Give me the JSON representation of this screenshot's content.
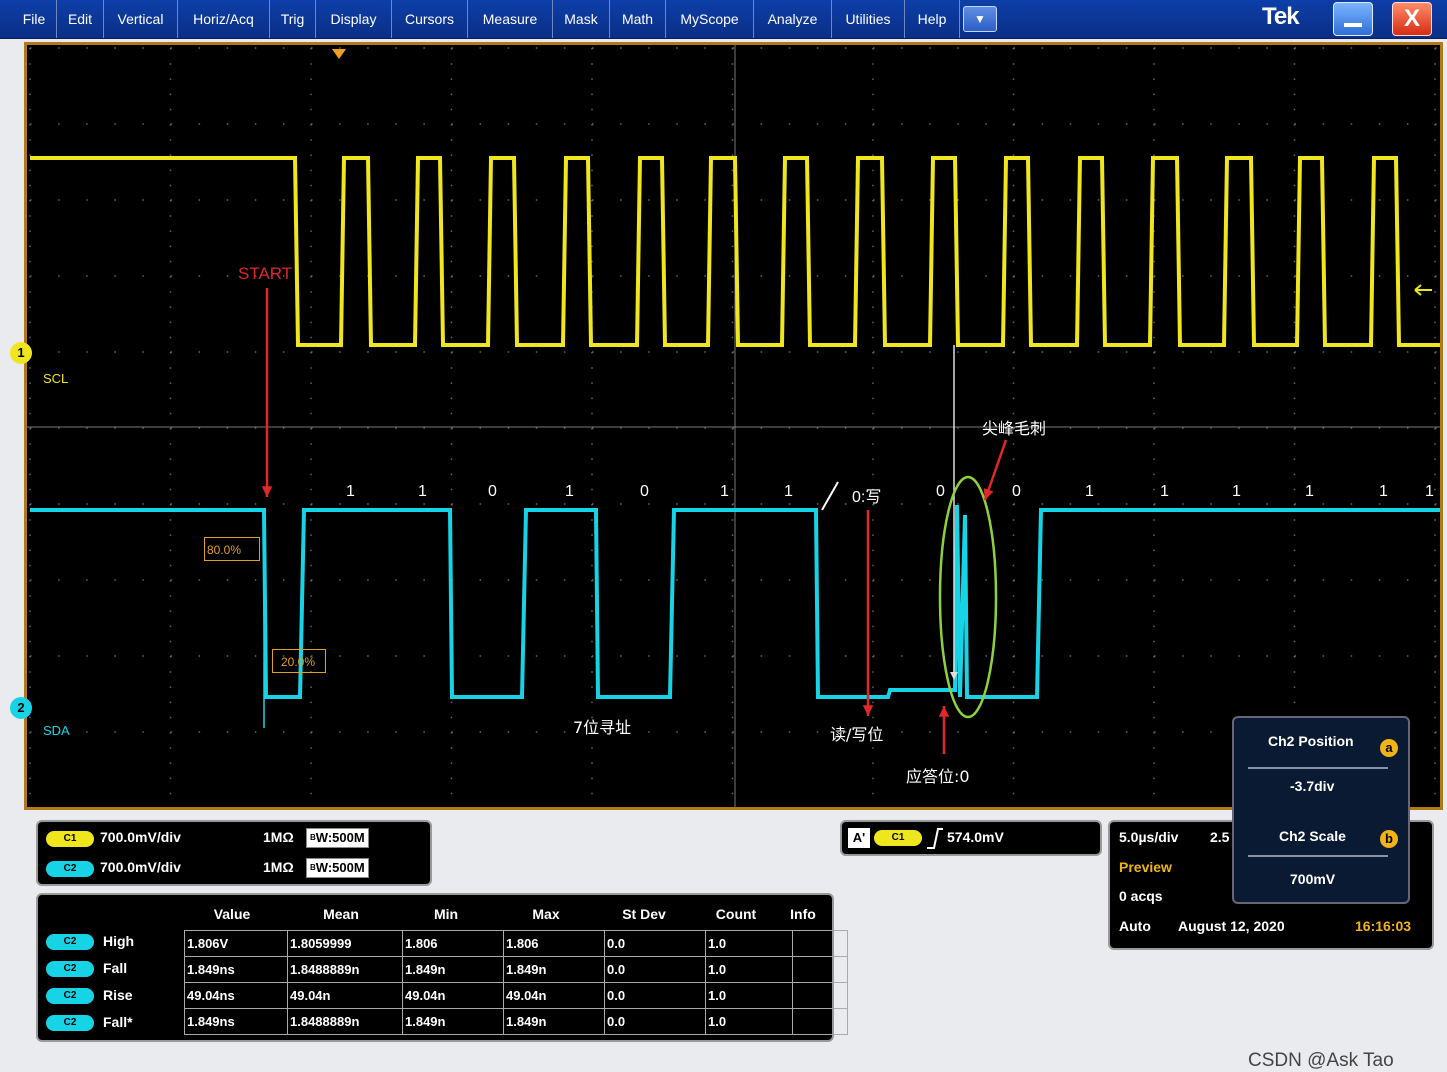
{
  "menubar": {
    "items": [
      "File",
      "Edit",
      "Vertical",
      "Horiz/Acq",
      "Trig",
      "Display",
      "Cursors",
      "Measure",
      "Mask",
      "Math",
      "MyScope",
      "Analyze",
      "Utilities",
      "Help"
    ],
    "brand": "Tek",
    "dropdown_icon": "chevron-down-icon",
    "close_glyph": "X"
  },
  "display": {
    "start_label": "START",
    "pct_high": "80.0%",
    "pct_low": "20.0%",
    "ch1_marker": "1",
    "ch2_marker": "2",
    "ch1_name": "SCL",
    "ch2_name": "SDA",
    "bits": [
      "1",
      "1",
      "0",
      "1",
      "0",
      "1",
      "1",
      "0:写",
      "0",
      "0",
      "1",
      "1",
      "1",
      "1",
      "1",
      "1"
    ],
    "annotations": {
      "glitch": "尖峰毛刺",
      "addr": "7位寻址",
      "rw": "读/写位",
      "ack": "应答位:0"
    },
    "colors": {
      "ch1": "#f0e61e",
      "ch2": "#16d4e6",
      "arrow": "#e02828",
      "ellipse": "#8fd13c",
      "frame": "#b07a1a"
    }
  },
  "channel_panel": {
    "c1": {
      "tag": "C1",
      "scale": "700.0mV/div",
      "impedance": "1MΩ",
      "bw": "W:500M"
    },
    "c2": {
      "tag": "C2",
      "scale": "700.0mV/div",
      "impedance": "1MΩ",
      "bw": "W:500M"
    }
  },
  "trigger_panel": {
    "mode": "A'",
    "source": "C1",
    "level": "574.0mV"
  },
  "acq_panel": {
    "timebase": "5.0µs/div",
    "rate_partial": "2.5",
    "preview": "Preview",
    "acqs": "0 acqs",
    "run_mode": "Auto",
    "date": "August 12, 2020",
    "time": "16:16:03"
  },
  "measurements": {
    "headers": [
      "Value",
      "Mean",
      "Min",
      "Max",
      "St Dev",
      "Count",
      "Info"
    ],
    "rows": [
      {
        "tag": "C2",
        "name": "High",
        "values": [
          "1.806V",
          "1.8059999",
          "1.806",
          "1.806",
          "0.0",
          "1.0",
          ""
        ]
      },
      {
        "tag": "C2",
        "name": "Fall",
        "values": [
          "1.849ns",
          "1.8488889n",
          "1.849n",
          "1.849n",
          "0.0",
          "1.0",
          ""
        ]
      },
      {
        "tag": "C2",
        "name": "Rise",
        "values": [
          "49.04ns",
          "49.04n",
          "49.04n",
          "49.04n",
          "0.0",
          "1.0",
          ""
        ]
      },
      {
        "tag": "C2",
        "name": "Fall*",
        "values": [
          "1.849ns",
          "1.8488889n",
          "1.849n",
          "1.849n",
          "0.0",
          "1.0",
          ""
        ]
      }
    ]
  },
  "popup": {
    "position_label": "Ch2 Position",
    "position_value": "-3.7div",
    "scale_label": "Ch2 Scale",
    "scale_value": "700mV",
    "badge_a": "a",
    "badge_b": "b"
  },
  "watermark": "CSDN @Ask Tao"
}
